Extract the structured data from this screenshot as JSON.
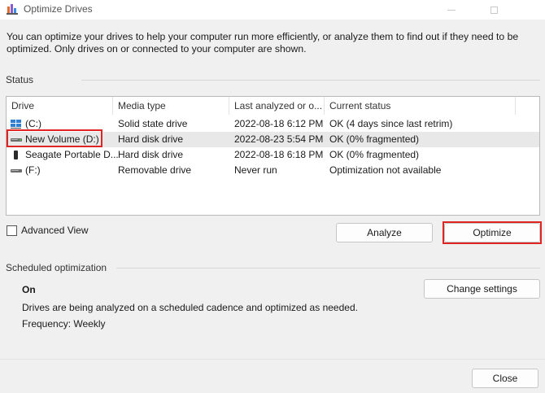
{
  "window": {
    "title": "Optimize Drives"
  },
  "description": "You can optimize your drives to help your computer run more efficiently, or analyze them to find out if they need to be optimized. Only drives on or connected to your computer are shown.",
  "status": {
    "label": "Status",
    "columns": [
      "Drive",
      "Media type",
      "Last analyzed or o...",
      "Current status"
    ],
    "rows": [
      {
        "drive": "(C:)",
        "media": "Solid state drive",
        "last": "2022-08-18 6:12 PM",
        "status": "OK (4 days since last retrim)",
        "icon": "ssd-icon"
      },
      {
        "drive": "New Volume (D:)",
        "media": "Hard disk drive",
        "last": "2022-08-23 5:54 PM",
        "status": "OK (0% fragmented)",
        "icon": "hdd-icon",
        "selected": true
      },
      {
        "drive": "Seagate Portable D...",
        "media": "Hard disk drive",
        "last": "2022-08-18 6:18 PM",
        "status": "OK (0% fragmented)",
        "icon": "portable-drive-icon"
      },
      {
        "drive": "(F:)",
        "media": "Removable drive",
        "last": "Never run",
        "status": "Optimization not available",
        "icon": "removable-drive-icon"
      }
    ]
  },
  "advanced_view": {
    "label": "Advanced View",
    "checked": false
  },
  "buttons": {
    "analyze": "Analyze",
    "optimize": "Optimize",
    "change_settings": "Change settings",
    "close": "Close"
  },
  "scheduled": {
    "label": "Scheduled optimization",
    "state": "On",
    "description": "Drives are being analyzed on a scheduled cadence and optimized as needed.",
    "frequency": "Frequency: Weekly"
  },
  "colors": {
    "highlight": "#e02323",
    "selected_row": "#e8e8e8"
  }
}
